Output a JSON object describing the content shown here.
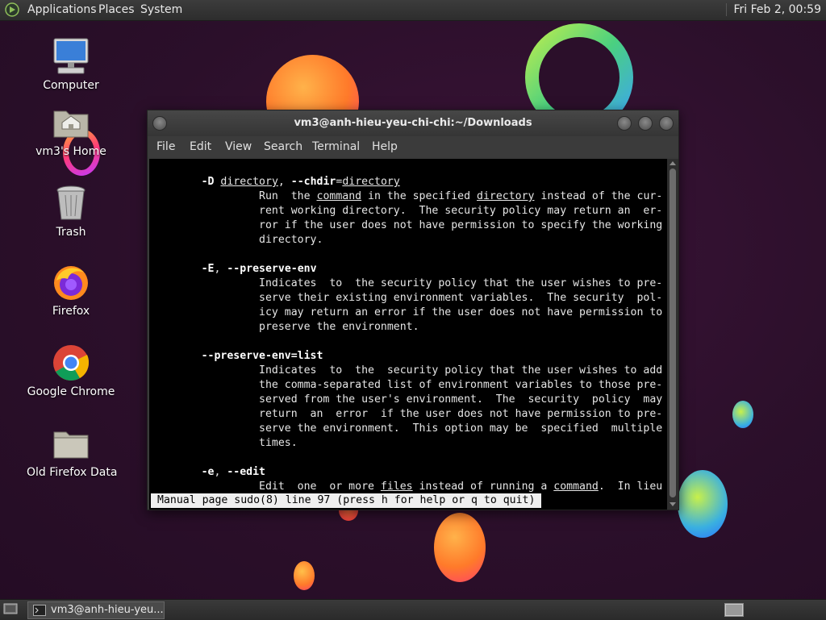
{
  "top_panel": {
    "menus": [
      "Applications",
      "Places",
      "System"
    ],
    "clock": "Fri Feb  2, 00:59"
  },
  "desktop_icons": [
    {
      "label": "Computer",
      "icon": "computer-icon"
    },
    {
      "label": "vm3's Home",
      "icon": "home-folder-icon"
    },
    {
      "label": "Trash",
      "icon": "trash-icon"
    },
    {
      "label": "Firefox",
      "icon": "firefox-icon"
    },
    {
      "label": "Google Chrome",
      "icon": "chrome-icon"
    },
    {
      "label": "Old Firefox Data",
      "icon": "folder-icon"
    }
  ],
  "terminal": {
    "title": "vm3@anh-hieu-yeu-chi-chi:~/Downloads",
    "menu": [
      "File",
      "Edit",
      "View",
      "Search",
      "Terminal",
      "Help"
    ],
    "status": "Manual page sudo(8) line 97 (press h for help or q to quit)"
  },
  "taskbar": {
    "window_button": "vm3@anh-hieu-yeu..."
  }
}
